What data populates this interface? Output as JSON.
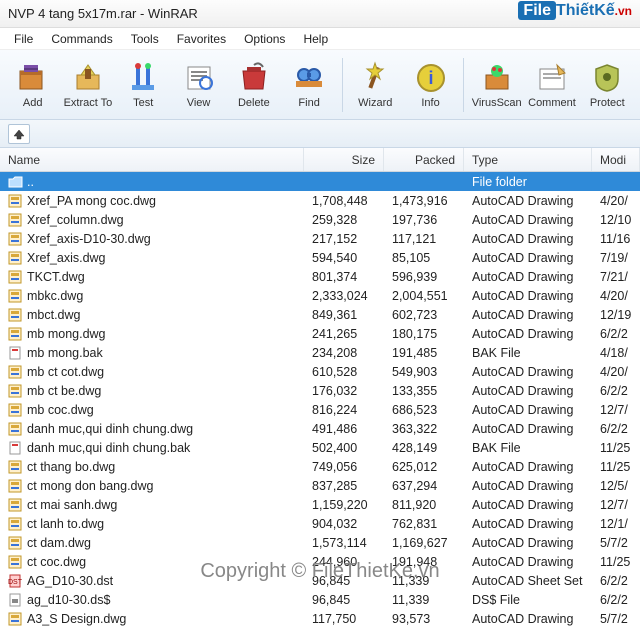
{
  "window": {
    "title": "NVP 4 tang 5x17m.rar - WinRAR"
  },
  "logo": {
    "file": "File",
    "thietke": "ThiếtKế",
    "vn": ".vn"
  },
  "menu": [
    "File",
    "Commands",
    "Tools",
    "Favorites",
    "Options",
    "Help"
  ],
  "toolbar": [
    {
      "label": "Add",
      "icon": "add"
    },
    {
      "label": "Extract To",
      "icon": "extract"
    },
    {
      "label": "Test",
      "icon": "test"
    },
    {
      "label": "View",
      "icon": "view"
    },
    {
      "label": "Delete",
      "icon": "delete"
    },
    {
      "label": "Find",
      "icon": "find"
    },
    {
      "label": "Wizard",
      "icon": "wizard"
    },
    {
      "label": "Info",
      "icon": "info"
    },
    {
      "label": "VirusScan",
      "icon": "virus"
    },
    {
      "label": "Comment",
      "icon": "comment"
    },
    {
      "label": "Protect",
      "icon": "protect"
    }
  ],
  "columns": {
    "name": "Name",
    "size": "Size",
    "packed": "Packed",
    "type": "Type",
    "mod": "Modi"
  },
  "parent": {
    "name": "..",
    "type": "File folder"
  },
  "files": [
    {
      "name": "Xref_PA mong coc.dwg",
      "size": "1,708,448",
      "packed": "1,473,916",
      "type": "AutoCAD Drawing",
      "mod": "4/20/",
      "icon": "dwg"
    },
    {
      "name": "Xref_column.dwg",
      "size": "259,328",
      "packed": "197,736",
      "type": "AutoCAD Drawing",
      "mod": "12/10",
      "icon": "dwg"
    },
    {
      "name": "Xref_axis-D10-30.dwg",
      "size": "217,152",
      "packed": "117,121",
      "type": "AutoCAD Drawing",
      "mod": "11/16",
      "icon": "dwg"
    },
    {
      "name": "Xref_axis.dwg",
      "size": "594,540",
      "packed": "85,105",
      "type": "AutoCAD Drawing",
      "mod": "7/19/",
      "icon": "dwg"
    },
    {
      "name": "TKCT.dwg",
      "size": "801,374",
      "packed": "596,939",
      "type": "AutoCAD Drawing",
      "mod": "7/21/",
      "icon": "dwg"
    },
    {
      "name": "mbkc.dwg",
      "size": "2,333,024",
      "packed": "2,004,551",
      "type": "AutoCAD Drawing",
      "mod": "4/20/",
      "icon": "dwg"
    },
    {
      "name": "mbct.dwg",
      "size": "849,361",
      "packed": "602,723",
      "type": "AutoCAD Drawing",
      "mod": "12/19",
      "icon": "dwg"
    },
    {
      "name": "mb mong.dwg",
      "size": "241,265",
      "packed": "180,175",
      "type": "AutoCAD Drawing",
      "mod": "6/2/2",
      "icon": "dwg"
    },
    {
      "name": "mb mong.bak",
      "size": "234,208",
      "packed": "191,485",
      "type": "BAK File",
      "mod": "4/18/",
      "icon": "bak"
    },
    {
      "name": "mb ct cot.dwg",
      "size": "610,528",
      "packed": "549,903",
      "type": "AutoCAD Drawing",
      "mod": "4/20/",
      "icon": "dwg"
    },
    {
      "name": "mb ct be.dwg",
      "size": "176,032",
      "packed": "133,355",
      "type": "AutoCAD Drawing",
      "mod": "6/2/2",
      "icon": "dwg"
    },
    {
      "name": "mb coc.dwg",
      "size": "816,224",
      "packed": "686,523",
      "type": "AutoCAD Drawing",
      "mod": "12/7/",
      "icon": "dwg"
    },
    {
      "name": "danh muc,qui dinh chung.dwg",
      "size": "491,486",
      "packed": "363,322",
      "type": "AutoCAD Drawing",
      "mod": "6/2/2",
      "icon": "dwg"
    },
    {
      "name": "danh muc,qui dinh chung.bak",
      "size": "502,400",
      "packed": "428,149",
      "type": "BAK File",
      "mod": "11/25",
      "icon": "bak"
    },
    {
      "name": "ct thang bo.dwg",
      "size": "749,056",
      "packed": "625,012",
      "type": "AutoCAD Drawing",
      "mod": "11/25",
      "icon": "dwg"
    },
    {
      "name": "ct mong don bang.dwg",
      "size": "837,285",
      "packed": "637,294",
      "type": "AutoCAD Drawing",
      "mod": "12/5/",
      "icon": "dwg"
    },
    {
      "name": "ct mai sanh.dwg",
      "size": "1,159,220",
      "packed": "811,920",
      "type": "AutoCAD Drawing",
      "mod": "12/7/",
      "icon": "dwg"
    },
    {
      "name": "ct lanh to.dwg",
      "size": "904,032",
      "packed": "762,831",
      "type": "AutoCAD Drawing",
      "mod": "12/1/",
      "icon": "dwg"
    },
    {
      "name": "ct dam.dwg",
      "size": "1,573,114",
      "packed": "1,169,627",
      "type": "AutoCAD Drawing",
      "mod": "5/7/2",
      "icon": "dwg"
    },
    {
      "name": "ct coc.dwg",
      "size": "244,960",
      "packed": "191,948",
      "type": "AutoCAD Drawing",
      "mod": "11/25",
      "icon": "dwg"
    },
    {
      "name": "AG_D10-30.dst",
      "size": "96,845",
      "packed": "11,339",
      "type": "AutoCAD Sheet Set",
      "mod": "6/2/2",
      "icon": "dst"
    },
    {
      "name": "ag_d10-30.ds$",
      "size": "96,845",
      "packed": "11,339",
      "type": "DS$ File",
      "mod": "6/2/2",
      "icon": "ds"
    },
    {
      "name": "A3_S Design.dwg",
      "size": "117,750",
      "packed": "93,573",
      "type": "AutoCAD Drawing",
      "mod": "5/7/2",
      "icon": "dwg"
    }
  ],
  "copyright": "Copyright © FileThietKe.vn"
}
